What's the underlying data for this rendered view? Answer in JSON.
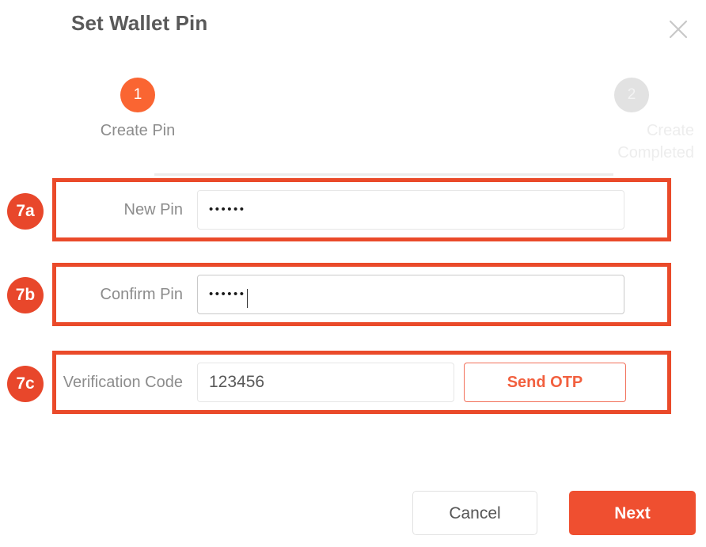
{
  "dialog": {
    "title": "Set Wallet Pin",
    "close_icon": "close-icon"
  },
  "stepper": {
    "steps": [
      {
        "number": "1",
        "label": "Create Pin",
        "state": "active"
      },
      {
        "number": "2",
        "label": "Create Completed",
        "state": "inactive"
      }
    ]
  },
  "form": {
    "rows": [
      {
        "badge": "7a",
        "label": "New Pin",
        "value": "••••••",
        "type": "password",
        "focused": false
      },
      {
        "badge": "7b",
        "label": "Confirm Pin",
        "value": "••••••",
        "type": "password",
        "focused": true
      },
      {
        "badge": "7c",
        "label": "Verification Code",
        "value": "123456",
        "type": "text",
        "focused": false,
        "action_label": "Send OTP"
      }
    ]
  },
  "footer": {
    "cancel_label": "Cancel",
    "next_label": "Next"
  },
  "colors": {
    "accent": "#ef4f30",
    "annotation": "#ea4a2a",
    "step_active": "#fa6532",
    "step_inactive": "#e2e2e2",
    "label_text": "#8c8c8c",
    "otp_text": "#f2603f"
  }
}
